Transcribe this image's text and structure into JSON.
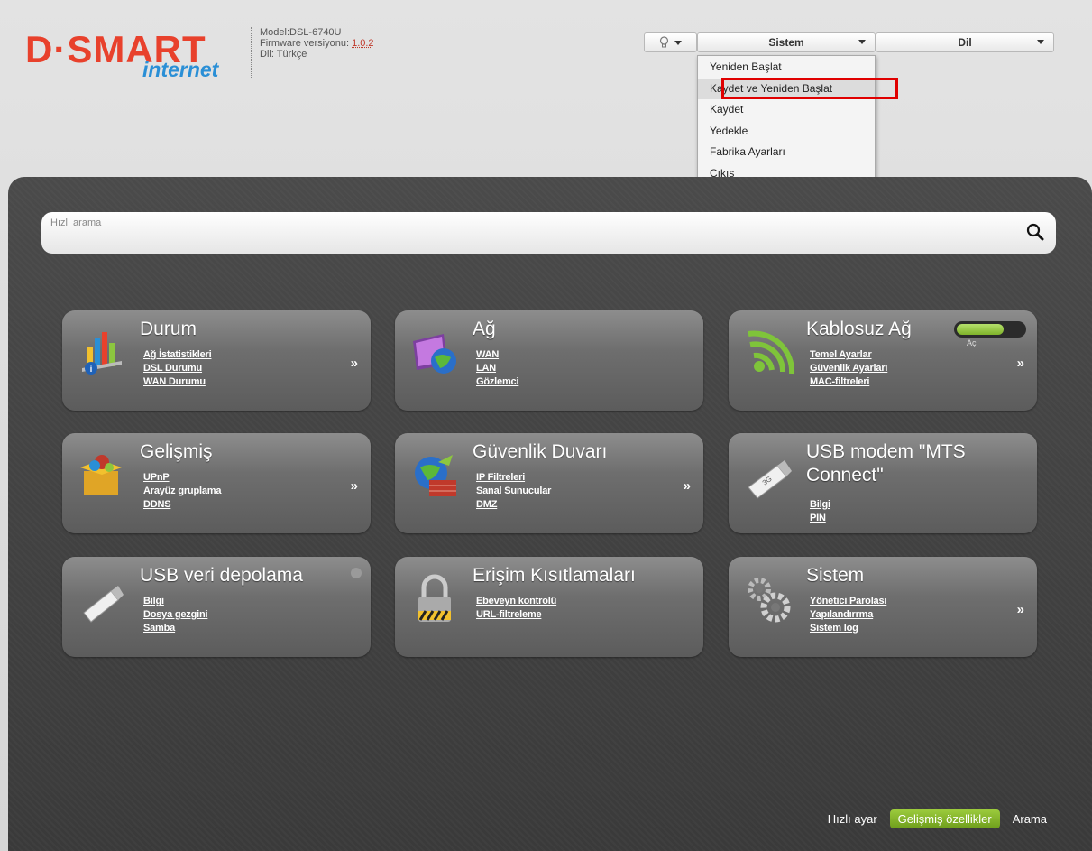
{
  "header": {
    "brand": "D·SMART",
    "brand_sub": "internet",
    "model": "Model:DSL-6740U",
    "firmware_label": "Firmware versiyonu: ",
    "firmware_value": "1.0.2",
    "language": "Dil: Türkçe"
  },
  "topbar": {
    "bulb_icon": "lightbulb-icon",
    "sistem_label": "Sistem",
    "dil_label": "Dil"
  },
  "dropdown": {
    "items": [
      "Yeniden Başlat",
      "Kaydet ve Yeniden Başlat",
      "Kaydet",
      "Yedekle",
      "Fabrika Ayarları",
      "Çıkış"
    ],
    "highlighted_index": 1
  },
  "search": {
    "placeholder": "Hızlı arama"
  },
  "cards": [
    {
      "title": "Durum",
      "links": [
        "Ağ İstatistikleri",
        "DSL Durumu",
        "WAN Durumu"
      ],
      "more": "»"
    },
    {
      "title": "Ağ",
      "links": [
        "WAN",
        "LAN",
        "Gözlemci"
      ]
    },
    {
      "title": "Kablosuz Ağ",
      "links": [
        "Temel Ayarlar",
        "Güvenlik Ayarları",
        "MAC-filtreleri"
      ],
      "more": "»",
      "toggle_label": "Aç"
    },
    {
      "title": "Gelişmiş",
      "links": [
        "UPnP",
        "Arayüz gruplama",
        "DDNS"
      ],
      "more": "»"
    },
    {
      "title": "Güvenlik Duvarı",
      "links": [
        "IP Filtreleri",
        "Sanal Sunucular",
        "DMZ"
      ],
      "more": "»"
    },
    {
      "title": "USB modem \"MTS Connect\"",
      "links": [
        "Bilgi",
        "PIN"
      ]
    },
    {
      "title": "USB veri depolama",
      "links": [
        "Bilgi",
        "Dosya gezgini",
        "Samba"
      ]
    },
    {
      "title": "Erişim Kısıtlamaları",
      "links": [
        "Ebeveyn kontrolü",
        "URL-filtreleme"
      ]
    },
    {
      "title": "Sistem",
      "links": [
        "Yönetici Parolası",
        "Yapılandırrma",
        "Sistem log"
      ],
      "more": "»"
    }
  ],
  "bottom_nav": {
    "quick": "Hızlı ayar",
    "advanced": "Gelişmiş özellikler",
    "search": "Arama"
  },
  "colors": {
    "accent_green": "#8cc63f",
    "brand_red": "#e8412c",
    "brand_blue": "#2a8fd6",
    "highlight_red": "#e00000"
  }
}
